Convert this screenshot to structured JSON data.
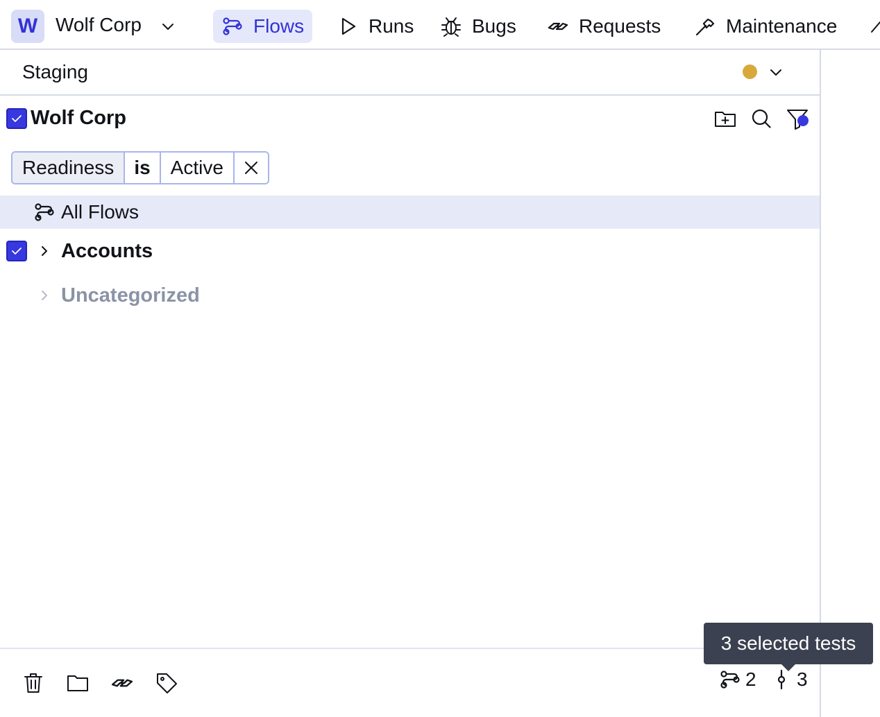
{
  "workspace": {
    "badge": "W",
    "name": "Wolf Corp"
  },
  "nav": {
    "items": [
      {
        "label": "Flows",
        "icon": "flows-icon",
        "active": true
      },
      {
        "label": "Runs",
        "icon": "play-icon",
        "active": false
      },
      {
        "label": "Bugs",
        "icon": "bug-icon",
        "active": false
      },
      {
        "label": "Requests",
        "icon": "handshake-icon",
        "active": false
      },
      {
        "label": "Maintenance",
        "icon": "hammer-icon",
        "active": false
      }
    ]
  },
  "environment": {
    "name": "Staging",
    "status_color": "#d8a93a"
  },
  "tree": {
    "root": {
      "name": "Wolf Corp",
      "checked": true
    },
    "filter": {
      "field": "Readiness",
      "operator": "is",
      "value": "Active"
    },
    "all_flows_label": "All Flows",
    "folders": [
      {
        "name": "Accounts",
        "checked": true,
        "muted": false
      },
      {
        "name": "Uncategorized",
        "checked": false,
        "muted": true
      }
    ]
  },
  "bottom": {
    "flows_count": "2",
    "tests_count": "3",
    "tooltip": "3 selected tests"
  },
  "colors": {
    "accent": "#3838e0",
    "border": "#d5dae4",
    "selected_row": "#e6eaf8"
  }
}
